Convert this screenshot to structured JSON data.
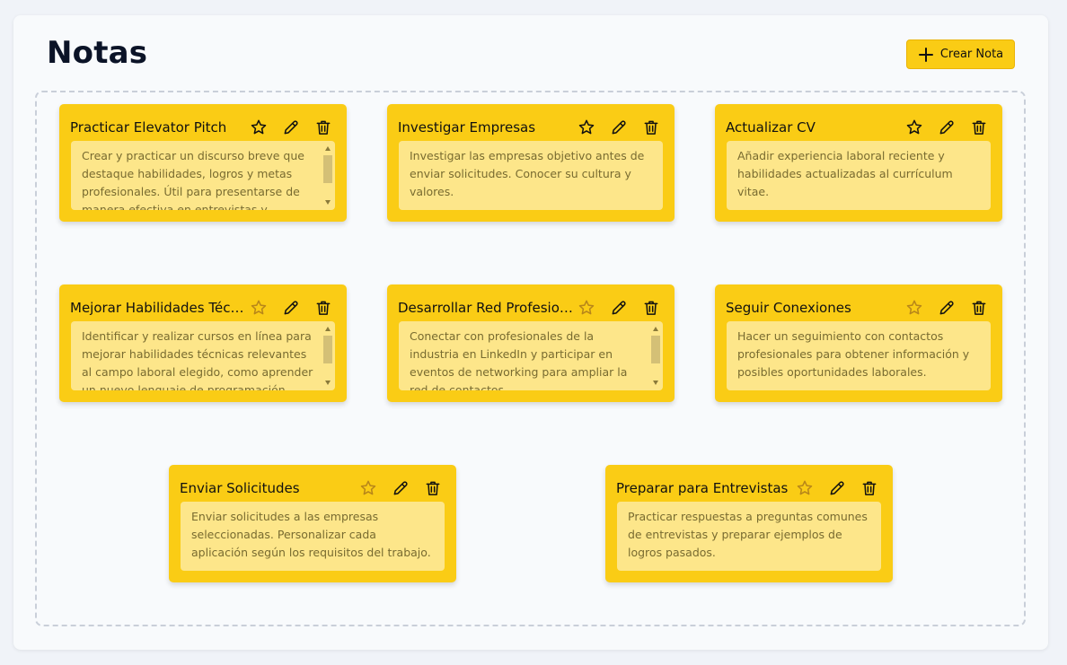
{
  "page": {
    "title": "Notas",
    "create_label": "Crear Nota"
  },
  "colors": {
    "note_bg": "#facc15",
    "note_body_bg": "#fde68a",
    "body_text": "#786b30",
    "star_outline": "#b7861a"
  },
  "icons": {
    "create": "plus-icon",
    "favorite": "star-icon",
    "edit": "pencil-icon",
    "delete": "trash-icon"
  },
  "notes": [
    {
      "title": "Practicar Elevator Pitch",
      "text": "Crear y practicar un discurso breve que destaque habilidades, logros y metas profesionales. Útil para presentarse de manera efectiva en entrevistas y eventos.",
      "scrollable": true
    },
    {
      "title": "Investigar Empresas",
      "text": "Investigar las empresas objetivo antes de enviar solicitudes. Conocer su cultura y valores.",
      "scrollable": false
    },
    {
      "title": "Actualizar CV",
      "text": "Añadir experiencia laboral reciente y habilidades actualizadas al currículum vitae.",
      "scrollable": false
    },
    {
      "title": "Mejorar Habilidades Técnicas",
      "text": "Identificar y realizar cursos en línea para mejorar habilidades técnicas relevantes al campo laboral elegido, como aprender un nuevo lenguaje de programación.",
      "scrollable": true
    },
    {
      "title": "Desarrollar Red Profesional",
      "text": "Conectar con profesionales de la industria en LinkedIn y participar en eventos de networking para ampliar la red de contactos.",
      "scrollable": true
    },
    {
      "title": "Seguir Conexiones",
      "text": "Hacer un seguimiento con contactos profesionales para obtener información y posibles oportunidades laborales.",
      "scrollable": false
    },
    {
      "title": "Enviar Solicitudes",
      "text": "Enviar solicitudes a las empresas seleccionadas. Personalizar cada aplicación según los requisitos del trabajo.",
      "scrollable": false
    },
    {
      "title": "Preparar para Entrevistas",
      "text": "Practicar respuestas a preguntas comunes de entrevistas y preparar ejemplos de logros pasados.",
      "scrollable": false
    }
  ]
}
